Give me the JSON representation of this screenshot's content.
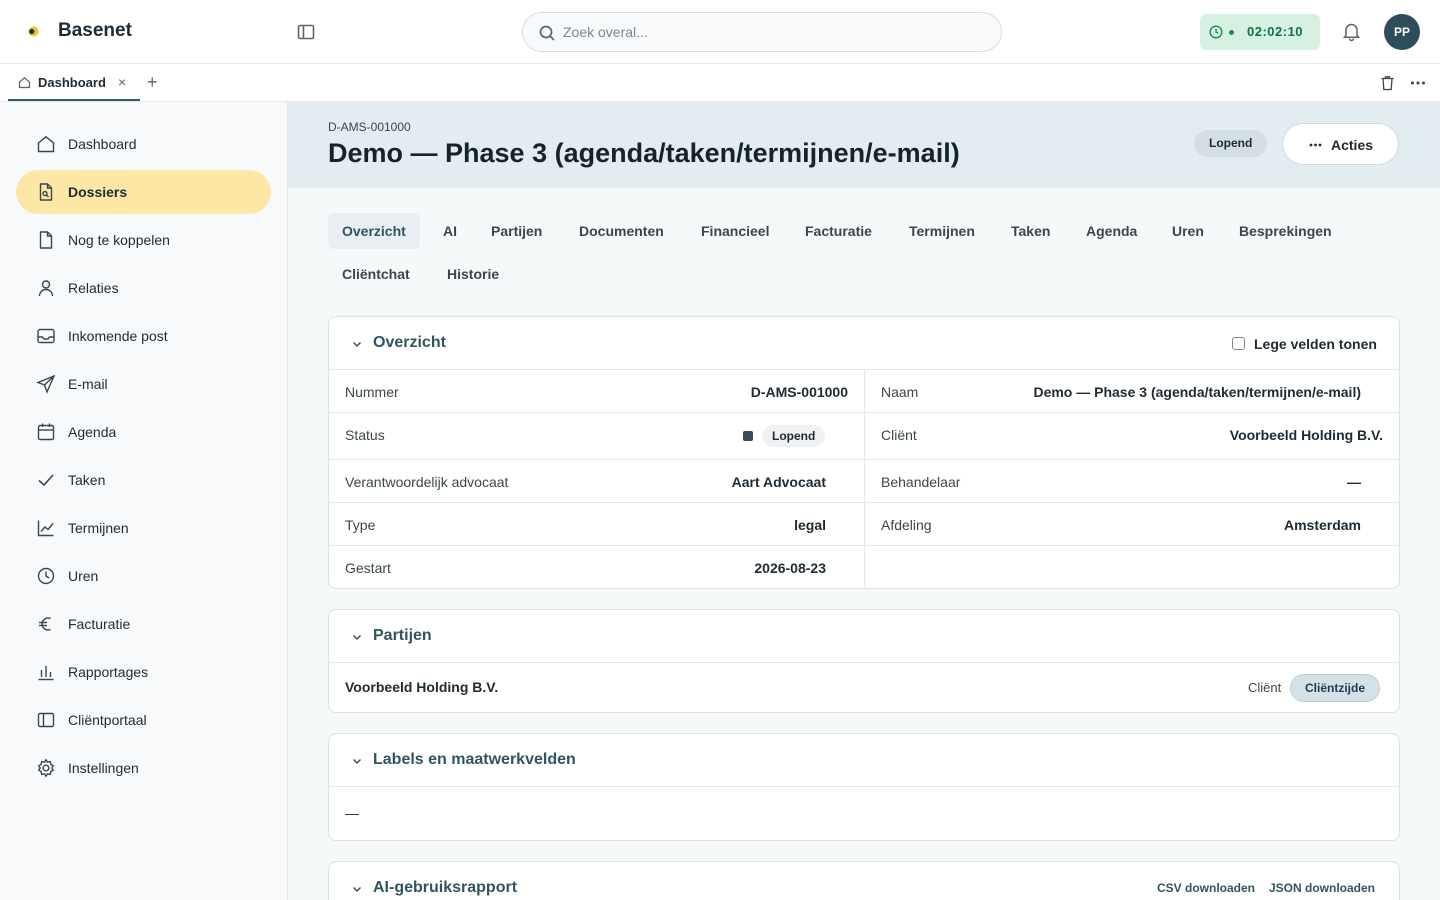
{
  "app": {
    "brand": "Basenet"
  },
  "search": {
    "placeholder": "Zoek overal..."
  },
  "timer": {
    "value": "02:02:10"
  },
  "user": {
    "initials": "PP"
  },
  "tabs": {
    "open": "Dashboard"
  },
  "sidebar": {
    "items": [
      {
        "label": "Dashboard",
        "icon": "home-icon"
      },
      {
        "label": "Dossiers",
        "icon": "file-icon",
        "active": true
      },
      {
        "label": "Nog te koppelen",
        "icon": "file-icon"
      },
      {
        "label": "Relaties",
        "icon": "user-icon"
      },
      {
        "label": "Inkomende post",
        "icon": "inbox-icon"
      },
      {
        "label": "E-mail",
        "icon": "send-icon"
      },
      {
        "label": "Agenda",
        "icon": "calendar-icon"
      },
      {
        "label": "Taken",
        "icon": "check-icon"
      },
      {
        "label": "Termijnen",
        "icon": "chart-line-icon"
      },
      {
        "label": "Uren",
        "icon": "clock-icon"
      },
      {
        "label": "Facturatie",
        "icon": "euro-icon"
      },
      {
        "label": "Rapportages",
        "icon": "bar-chart-icon"
      },
      {
        "label": "Cliëntportaal",
        "icon": "panel-icon"
      },
      {
        "label": "Instellingen",
        "icon": "gear-icon"
      }
    ]
  },
  "dossier": {
    "code": "D-AMS-001000",
    "title": "Demo — Phase 3 (agenda/taken/termijnen/e-mail)",
    "status": "Lopend",
    "actions_label": "Acties"
  },
  "content_tabs": [
    "Overzicht",
    "AI",
    "Partijen",
    "Documenten",
    "Financieel",
    "Facturatie",
    "Termijnen",
    "Taken",
    "Agenda",
    "Uren",
    "Besprekingen",
    "Cliëntchat",
    "Historie"
  ],
  "overview": {
    "title": "Overzicht",
    "empty_toggle": "Lege velden tonen",
    "fields": {
      "nummer_label": "Nummer",
      "nummer": "D-AMS-001000",
      "naam_label": "Naam",
      "naam": "Demo — Phase 3 (agenda/taken/termijnen/e-mail)",
      "status_label": "Status",
      "status": "Lopend",
      "client_label": "Cliënt",
      "client": "Voorbeeld Holding B.V.",
      "advocaat_label": "Verantwoordelijk advocaat",
      "advocaat": "Aart Advocaat",
      "behandelaar_label": "Behandelaar",
      "behandelaar": "—",
      "type_label": "Type",
      "type": "legal",
      "afdeling_label": "Afdeling",
      "afdeling": "Amsterdam",
      "gestart_label": "Gestart",
      "gestart": "2026-08-23"
    }
  },
  "parties": {
    "title": "Partijen",
    "name": "Voorbeeld Holding B.V.",
    "role": "Cliënt",
    "side": "Cliëntzijde"
  },
  "labels": {
    "title": "Labels en maatwerkvelden",
    "value": "—"
  },
  "ai_report": {
    "title": "AI-gebruiksrapport",
    "csv": "CSV downloaden",
    "json": "JSON downloaden"
  },
  "colors": {
    "accent": "#33545f",
    "active_nav": "#fde7a4",
    "timer_bg": "#d6f1e1"
  }
}
